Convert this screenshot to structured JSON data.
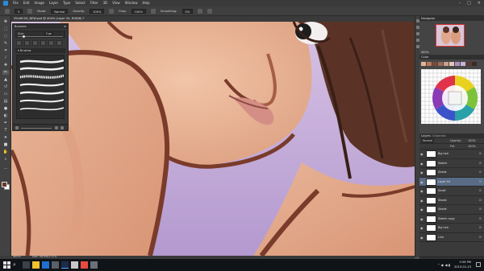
{
  "menubar": {
    "items": [
      "File",
      "Edit",
      "Image",
      "Layer",
      "Type",
      "Select",
      "Filter",
      "3D",
      "View",
      "Window",
      "Help"
    ]
  },
  "options": {
    "size_value": "3",
    "mode_label": "Mode:",
    "mode_value": "Normal",
    "opacity_label": "Opacity:",
    "opacity_value": "100%",
    "flow_label": "Flow:",
    "flow_value": "100%",
    "smoothing_label": "Smoothing:",
    "smoothing_value": "0%"
  },
  "document": {
    "tab_title": "39x46 DX_NEW.psd @ 400% (Layer 54, RGB/8) *"
  },
  "brushes_panel": {
    "title": "Brushes",
    "size_label": "Size:",
    "size_value": "3 px",
    "folder_label": "Brushes"
  },
  "navigator": {
    "title": "Navigator",
    "zoom": "400%"
  },
  "color_panel": {
    "title": "Color",
    "swatch_colors": [
      "#e3b39b",
      "#b97857",
      "#7a4a3a",
      "#9a6a58",
      "#c9a08c",
      "#e6c3b2",
      "#a98fbf",
      "#c9b2d9",
      "#5b3a2e",
      "#3b2a24"
    ]
  },
  "layers_panel": {
    "tabs": [
      "Layers",
      "Channels"
    ],
    "blend_mode": "Normal",
    "opacity_label": "Opacity:",
    "opacity_value": "100%",
    "fill_label": "Fill:",
    "fill_value": "100%",
    "layers": [
      {
        "name": "Big hair",
        "selected": false
      },
      {
        "name": "Sketch",
        "selected": false
      },
      {
        "name": "Shade",
        "selected": false
      },
      {
        "name": "Layer 54",
        "selected": true
      },
      {
        "name": "Small",
        "selected": false
      },
      {
        "name": "Shade",
        "selected": false
      },
      {
        "name": "Shade",
        "selected": false
      },
      {
        "name": "Sketch copy",
        "selected": false
      },
      {
        "name": "Big hair",
        "selected": false
      },
      {
        "name": "Line",
        "selected": false
      }
    ]
  },
  "status": {
    "zoom": "400%",
    "doc_size": "Doc: 56.9M/2.57G"
  },
  "taskbar": {
    "time": "5:56 PM",
    "date": "2019-01-23"
  },
  "icons": {
    "tools": [
      "move-icon",
      "marquee-icon",
      "lasso-icon",
      "quick-select-icon",
      "crop-icon",
      "eyedropper-icon",
      "healing-icon",
      "brush-icon",
      "stamp-icon",
      "history-brush-icon",
      "eraser-icon",
      "gradient-icon",
      "blur-icon",
      "dodge-icon",
      "pen-icon",
      "type-icon",
      "path-select-icon",
      "shape-icon",
      "hand-icon",
      "zoom-icon"
    ]
  }
}
